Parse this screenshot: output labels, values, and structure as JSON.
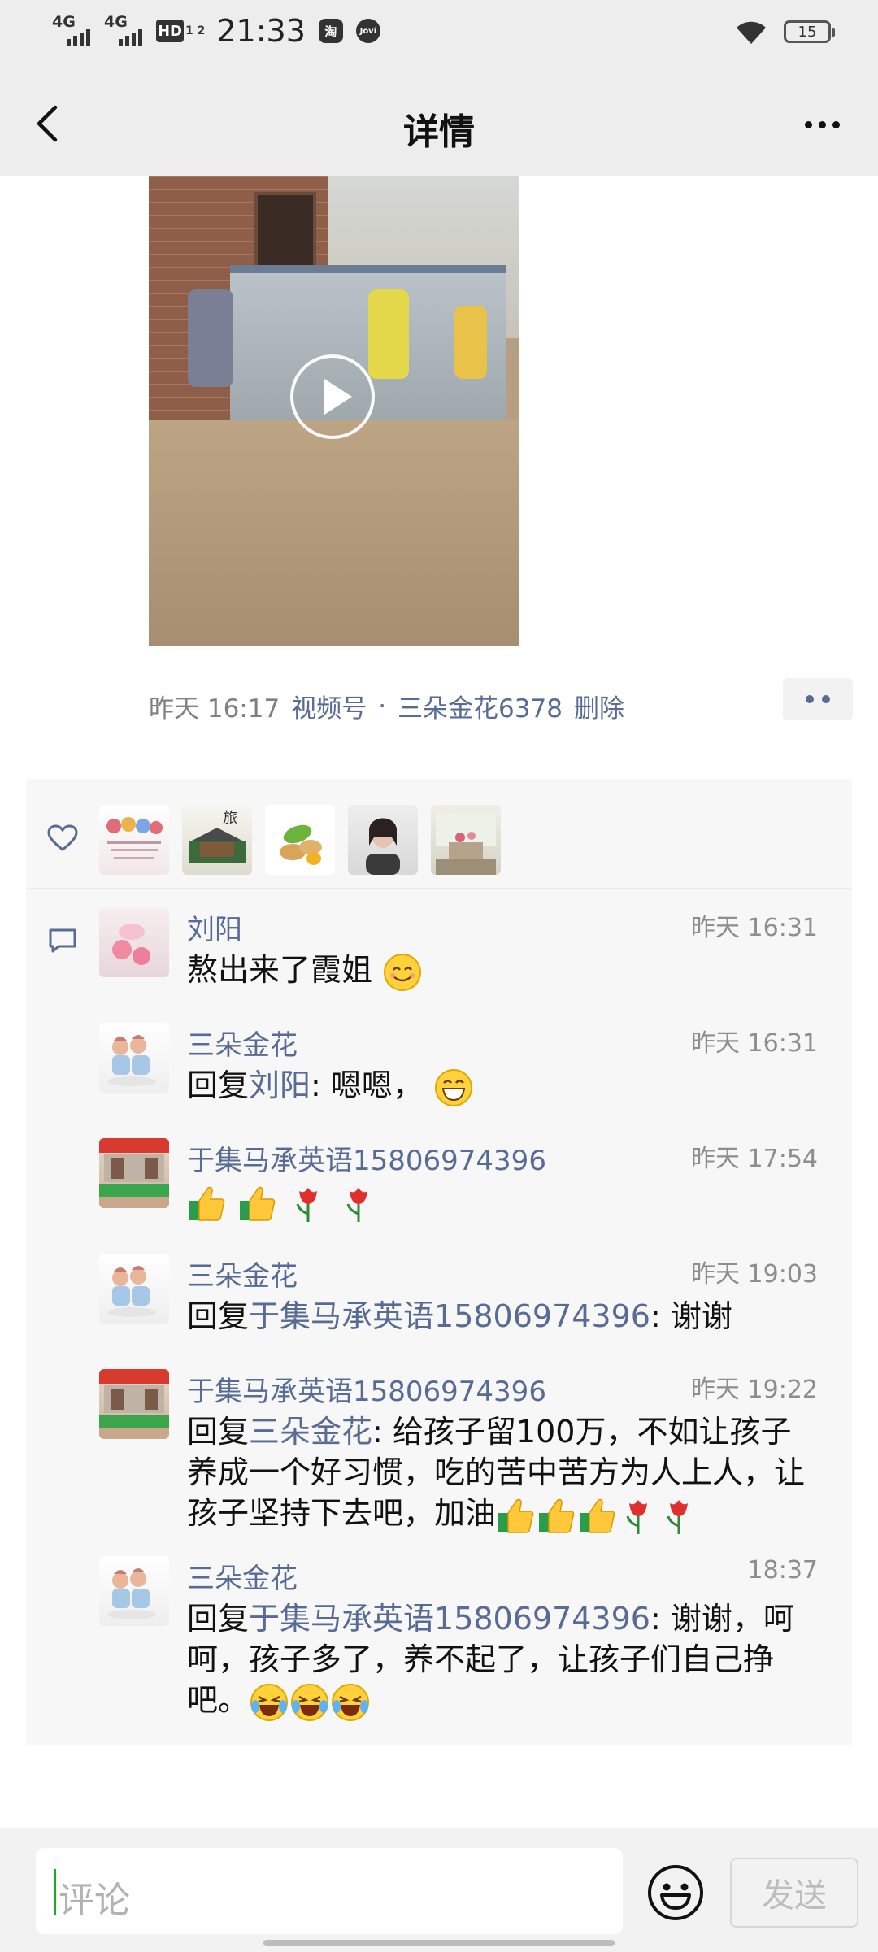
{
  "status_bar": {
    "signal_1": "4G",
    "signal_2": "4G",
    "hd": "HD",
    "hd_sub": "1 2",
    "time": "21:33",
    "app_1": "淘",
    "app_2": "Jovi",
    "battery": "15"
  },
  "nav": {
    "title": "详情"
  },
  "post": {
    "time": "昨天 16:17",
    "source": "视频号",
    "separator": "·",
    "author": "三朵金花6378",
    "delete": "删除"
  },
  "comments": [
    {
      "name": "刘阳",
      "time": "昨天 16:31",
      "reply_prefix": "",
      "reply_to": "",
      "reply_sep": "",
      "text": "熬出来了霞姐"
    },
    {
      "name": "三朵金花",
      "time": "昨天 16:31",
      "reply_prefix": "回复",
      "reply_to": "刘阳",
      "reply_sep": ": ",
      "text": "嗯嗯，"
    },
    {
      "name": "于集马承英语15806974396",
      "time": "昨天 17:54",
      "reply_prefix": "",
      "reply_to": "",
      "reply_sep": "",
      "text": ""
    },
    {
      "name": "三朵金花",
      "time": "昨天 19:03",
      "reply_prefix": "回复",
      "reply_to": "于集马承英语15806974396",
      "reply_sep": ": ",
      "text": "谢谢"
    },
    {
      "name": "于集马承英语15806974396",
      "time": "昨天 19:22",
      "reply_prefix": "回复",
      "reply_to": "三朵金花",
      "reply_sep": ": ",
      "text": "给孩子留100万，不如让孩子养成一个好习惯，吃的苦中苦方为人上人，让孩子坚持下去吧，加油"
    },
    {
      "name": "三朵金花",
      "time": "18:37",
      "reply_prefix": "回复",
      "reply_to": "于集马承英语15806974396",
      "reply_sep": ": ",
      "text": "谢谢，呵呵，孩子多了，养不起了，让孩子们自己挣吧。"
    }
  ],
  "input": {
    "placeholder": "评论",
    "send_label": "发送"
  },
  "colors": {
    "link": "#576b95",
    "panel": "#f7f7f7",
    "bar": "#ededed"
  },
  "icons": [
    "back-icon",
    "more-icon",
    "play-icon",
    "heart-icon",
    "comment-icon",
    "emoji-icon"
  ]
}
